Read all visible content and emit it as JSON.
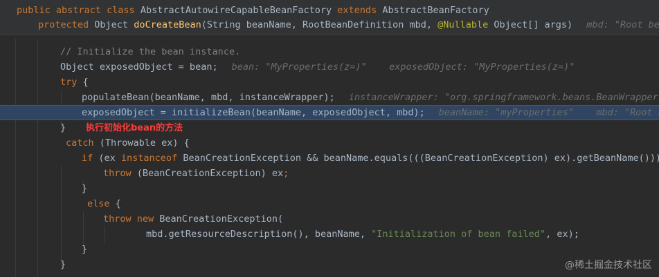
{
  "header": {
    "class_decl": {
      "kw1": "public abstract class ",
      "name": "AbstractAutowireCapableBeanFactory ",
      "kw2": "extends ",
      "parent": "AbstractBeanFactory"
    },
    "method_decl": {
      "kw": "protected ",
      "type": "Object ",
      "name": "doCreateBean",
      "params1": "(String beanName, RootBeanDefinition mbd, ",
      "ann": "@Nullable",
      "params2": " Object[] args)",
      "hint": "mbd: \"Root bean: c"
    }
  },
  "code": {
    "l1_comment": "// Initialize the bean instance.",
    "l2_code": "Object exposedObject = bean;",
    "l2_hint": "bean: \"MyProperties(z=)\"    exposedObject: \"MyProperties(z=)\"",
    "l3_kw": "try",
    "l3_rest": " {",
    "l4_code": "populateBean(beanName, mbd, instanceWrapper);",
    "l4_hint": "instanceWrapper: \"org.springframework.beans.BeanWrapperImpl",
    "l5_code": "exposedObject = initializeBean(beanName, exposedObject, mbd);",
    "l5_hint": "beanName: \"myProperties\"    mbd: \"Root bean",
    "l6_code": "}",
    "note": "执行初始化bean的方法",
    "l7_kw": "catch",
    "l7_rest": " (Throwable ex) {",
    "l8_kw": "if",
    "l8_a": " (ex ",
    "l8_kw2": "instanceof",
    "l8_b": " BeanCreationException && beanName.equals(((BeanCreationException) ex).getBeanName())) {",
    "l9_kw": "throw",
    "l9_rest": " (BeanCreationException) ex",
    "l9_semi": ";",
    "l10_code": "}",
    "l11_kw": "else",
    "l11_rest": " {",
    "l12_kw": "throw new",
    "l12_rest": " BeanCreationException(",
    "l13_a": "mbd.getResourceDescription(), beanName, ",
    "l13_str": "\"Initialization of bean failed\"",
    "l13_b": ", ex);",
    "l14_code": "}",
    "l15_code": "}"
  },
  "watermark": "@稀土掘金技术社区"
}
